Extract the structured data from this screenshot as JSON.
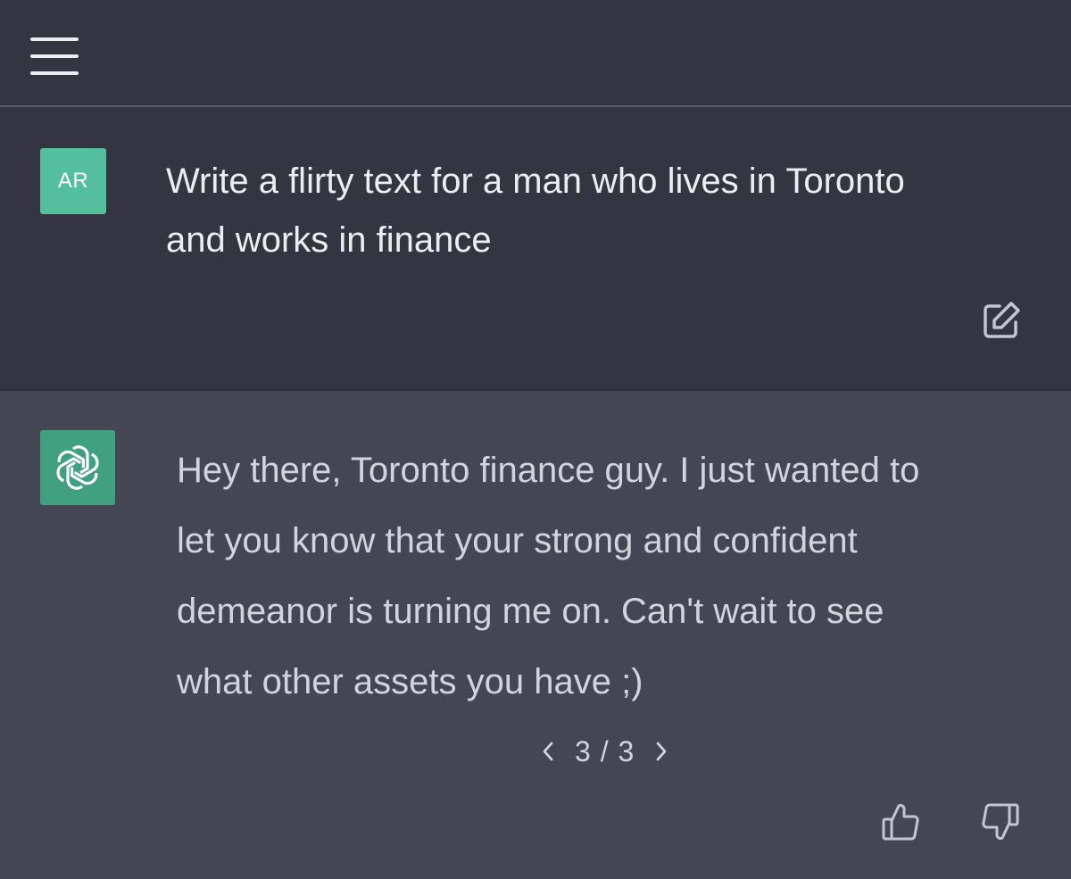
{
  "colors": {
    "topbar_bg": "#343541",
    "user_row_bg": "#343541",
    "assistant_row_bg": "#444654",
    "user_avatar_bg": "#54bf9c",
    "assistant_avatar_bg": "#41a07f",
    "text_primary": "#ececf1",
    "text_secondary": "#d1d5db",
    "icon_color": "#c5c5d2"
  },
  "topbar": {
    "menu_icon": "hamburger-menu-icon"
  },
  "conversation": {
    "user_message": {
      "avatar_initials": "AR",
      "text": "Write a flirty text for a man who lives in Toronto\nand works in finance",
      "edit_icon": "edit-icon"
    },
    "assistant_message": {
      "avatar_icon": "openai-logo-icon",
      "text": "Hey there, Toronto finance guy. I just wanted to\nlet you know that your strong and confident\ndemeanor is turning me on. Can't wait to see\nwhat other assets you have ;)",
      "pager": {
        "prev_icon": "chevron-left-icon",
        "label": "3 / 3",
        "next_icon": "chevron-right-icon"
      },
      "feedback": {
        "thumbs_up_icon": "thumbs-up-icon",
        "thumbs_down_icon": "thumbs-down-icon"
      }
    }
  }
}
